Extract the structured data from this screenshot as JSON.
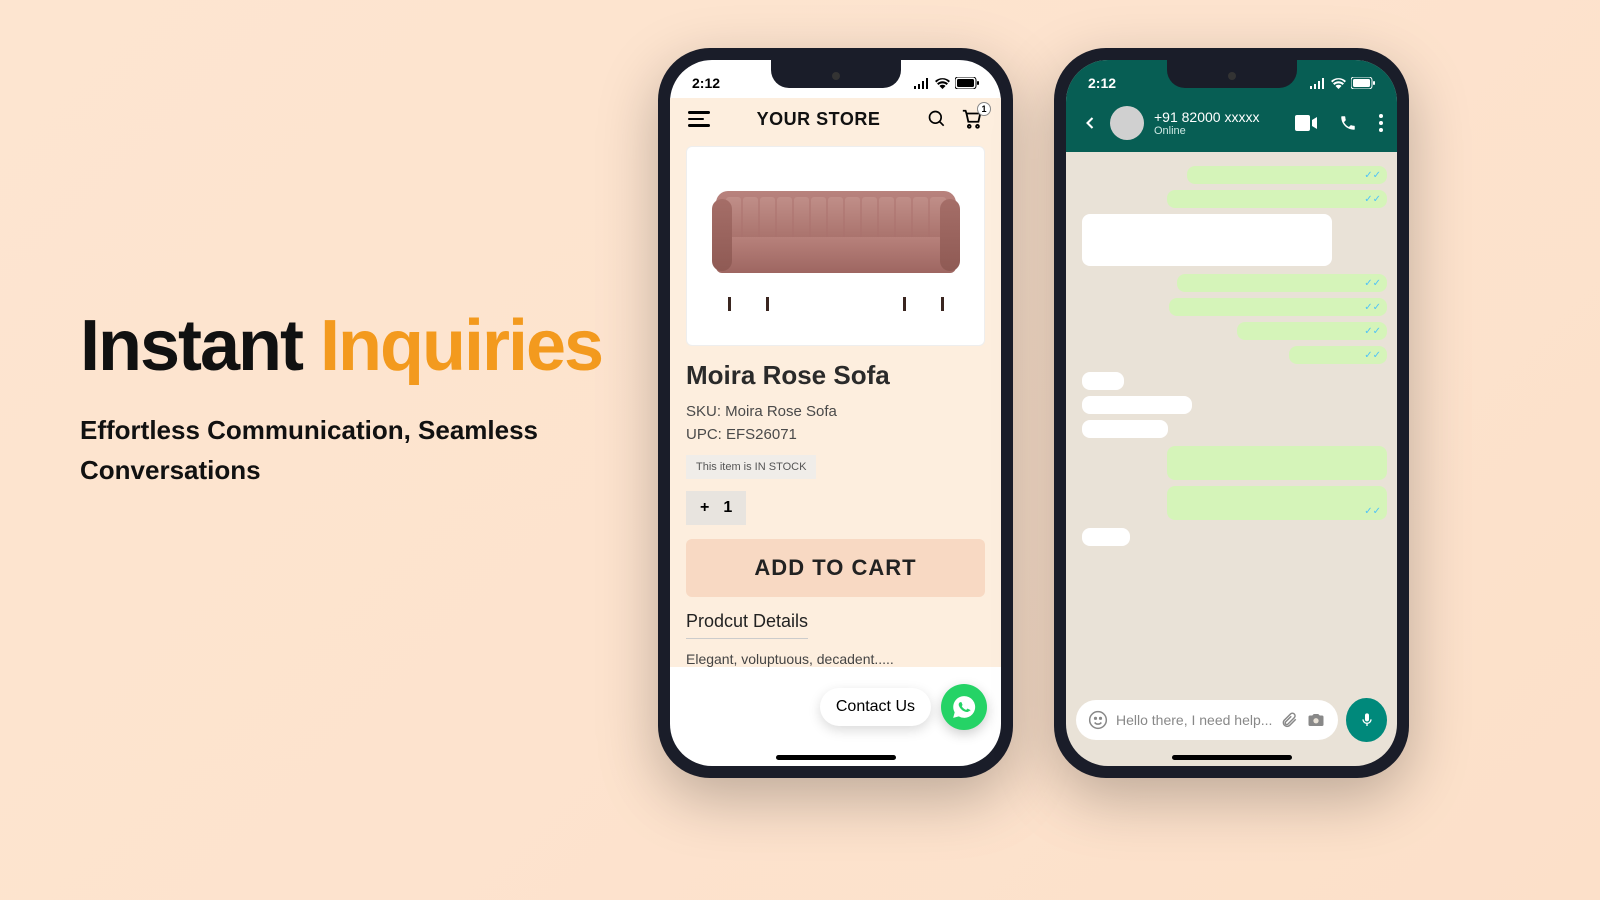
{
  "hero": {
    "title_word1": "Instant",
    "title_word2": "Inquiries",
    "subtitle": "Effortless Communication, Seamless Conversations"
  },
  "status_time": "2:12",
  "store": {
    "name": "YOUR STORE",
    "cart_count": "1",
    "product_name": "Moira Rose Sofa",
    "sku": "SKU: Moira Rose Sofa",
    "upc": "UPC: EFS26071",
    "stock_label": "This item is IN STOCK",
    "qty_plus": "+",
    "qty_value": "1",
    "add_to_cart": "ADD TO CART",
    "details_heading": "Prodcut Details",
    "description": "Elegant, voluptuous, decadent.....",
    "contact_label": "Contact Us"
  },
  "whatsapp": {
    "phone": "+91 82000 xxxxx",
    "status": "Online",
    "input_placeholder": "Hello there, I need help..."
  }
}
